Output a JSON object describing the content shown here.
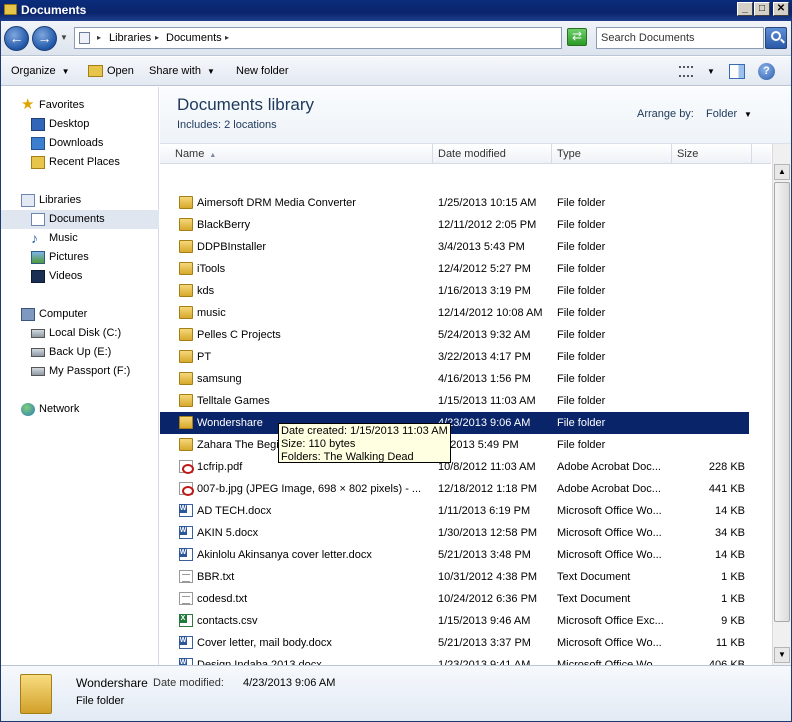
{
  "window": {
    "title": "Documents",
    "min_glyph": "_",
    "max_glyph": "□",
    "close_glyph": "✕"
  },
  "address": {
    "back_glyph": "←",
    "forward_glyph": "→",
    "breadcrumb": [
      "Libraries",
      "Documents"
    ],
    "refresh_glyph": "⇄",
    "search_placeholder": "Search Documents"
  },
  "toolbar": {
    "organize": "Organize",
    "open": "Open",
    "share_with": "Share with",
    "new_folder": "New folder",
    "help_glyph": "?"
  },
  "nav": {
    "favorites_label": "Favorites",
    "favorites": [
      "Desktop",
      "Downloads",
      "Recent Places"
    ],
    "libraries_label": "Libraries",
    "libraries": [
      "Documents",
      "Music",
      "Pictures",
      "Videos"
    ],
    "computer_label": "Computer",
    "drives": [
      "Local Disk (C:)",
      "Back Up (E:)",
      "My Passport (F:)"
    ],
    "network_label": "Network",
    "selected": "Documents"
  },
  "library": {
    "title": "Documents library",
    "includes": "Includes:  2 locations",
    "arrange_label": "Arrange by:",
    "arrange_value": "Folder"
  },
  "columns": {
    "name": "Name",
    "date": "Date modified",
    "type": "Type",
    "size": "Size"
  },
  "files": [
    {
      "name": "Aimersoft DRM Media Converter",
      "date": "1/25/2013 10:15 AM",
      "type": "File folder",
      "size": "",
      "icon": "folder"
    },
    {
      "name": "BlackBerry",
      "date": "12/11/2012 2:05 PM",
      "type": "File folder",
      "size": "",
      "icon": "folder"
    },
    {
      "name": "DDPBInstaller",
      "date": "3/4/2013 5:43 PM",
      "type": "File folder",
      "size": "",
      "icon": "folder"
    },
    {
      "name": "iTools",
      "date": "12/4/2012 5:27 PM",
      "type": "File folder",
      "size": "",
      "icon": "folder"
    },
    {
      "name": "kds",
      "date": "1/16/2013 3:19 PM",
      "type": "File folder",
      "size": "",
      "icon": "folder"
    },
    {
      "name": "music",
      "date": "12/14/2012 10:08 AM",
      "type": "File folder",
      "size": "",
      "icon": "folder"
    },
    {
      "name": "Pelles C Projects",
      "date": "5/24/2013 9:32 AM",
      "type": "File folder",
      "size": "",
      "icon": "folder"
    },
    {
      "name": "PT",
      "date": "3/22/2013 4:17 PM",
      "type": "File folder",
      "size": "",
      "icon": "folder"
    },
    {
      "name": "samsung",
      "date": "4/16/2013 1:56 PM",
      "type": "File folder",
      "size": "",
      "icon": "folder"
    },
    {
      "name": "Telltale Games",
      "date": "1/15/2013 11:03 AM",
      "type": "File folder",
      "size": "",
      "icon": "folder"
    },
    {
      "name": "Wondershare",
      "date": "4/23/2013 9:06 AM",
      "type": "File folder",
      "size": "",
      "icon": "folder",
      "selected": true
    },
    {
      "name": "Zahara The Begin",
      "date": "/3/2013 5:49 PM",
      "type": "File folder",
      "size": "",
      "icon": "folder"
    },
    {
      "name": "1cfrip.pdf",
      "date": "10/8/2012 11:03 AM",
      "type": "Adobe Acrobat Doc...",
      "size": "228 KB",
      "icon": "pdf"
    },
    {
      "name": "007-b.jpg (JPEG Image, 698 × 802 pixels) - ...",
      "date": "12/18/2012 1:18 PM",
      "type": "Adobe Acrobat Doc...",
      "size": "441 KB",
      "icon": "pdf"
    },
    {
      "name": "AD TECH.docx",
      "date": "1/11/2013 6:19 PM",
      "type": "Microsoft Office Wo...",
      "size": "14 KB",
      "icon": "word"
    },
    {
      "name": "AKIN 5.docx",
      "date": "1/30/2013 12:58 PM",
      "type": "Microsoft Office Wo...",
      "size": "34 KB",
      "icon": "word"
    },
    {
      "name": "Akinlolu Akinsanya cover letter.docx",
      "date": "5/21/2013 3:48 PM",
      "type": "Microsoft Office Wo...",
      "size": "14 KB",
      "icon": "word"
    },
    {
      "name": "BBR.txt",
      "date": "10/31/2012 4:38 PM",
      "type": "Text Document",
      "size": "1 KB",
      "icon": "txt"
    },
    {
      "name": "codesd.txt",
      "date": "10/24/2012 6:36 PM",
      "type": "Text Document",
      "size": "1 KB",
      "icon": "txt"
    },
    {
      "name": "contacts.csv",
      "date": "1/15/2013 9:46 AM",
      "type": "Microsoft Office Exc...",
      "size": "9 KB",
      "icon": "xls"
    },
    {
      "name": "Cover letter, mail body.docx",
      "date": "5/21/2013 3:37 PM",
      "type": "Microsoft Office Wo...",
      "size": "11 KB",
      "icon": "word"
    },
    {
      "name": "Design Indaba 2013.docx",
      "date": "1/23/2013 9:41 AM",
      "type": "Microsoft Office Wo...",
      "size": "406 KB",
      "icon": "word"
    }
  ],
  "tooltip": {
    "created": "Date created: 1/15/2013 11:03 AM",
    "size": "Size: 110 bytes",
    "folders": "Folders: The Walking Dead"
  },
  "details": {
    "name": "Wondershare",
    "modified_label": "Date modified:",
    "modified_value": "4/23/2013 9:06 AM",
    "type": "File folder"
  }
}
